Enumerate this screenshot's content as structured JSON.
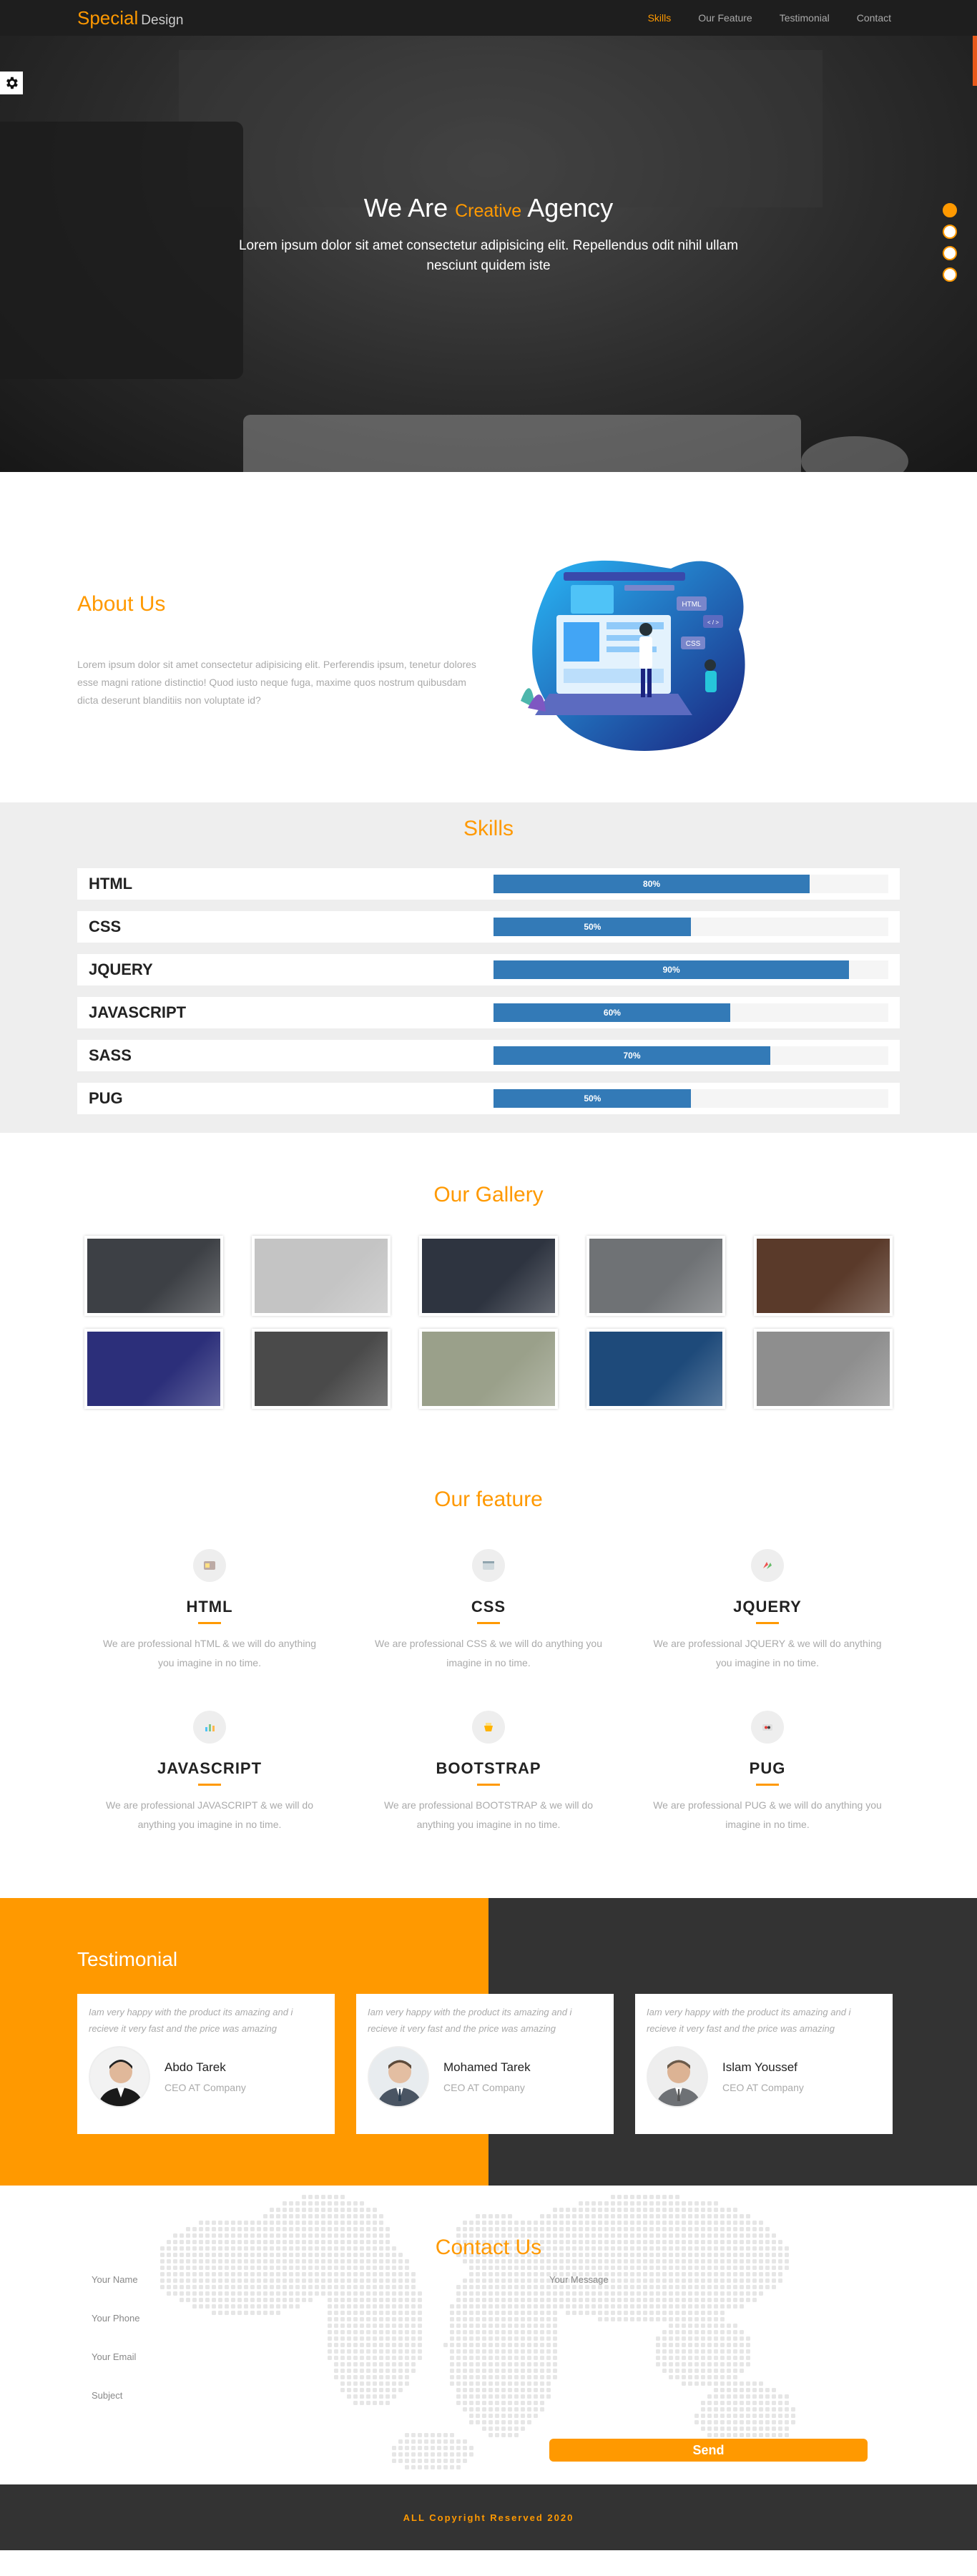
{
  "header": {
    "logo_brand": "Special",
    "logo_rest": "Design",
    "nav": [
      {
        "label": "Skills",
        "active": true
      },
      {
        "label": "Our Feature",
        "active": false
      },
      {
        "label": "Testimonial",
        "active": false
      },
      {
        "label": "Contact",
        "active": false
      }
    ]
  },
  "hero": {
    "title_start": "We Are",
    "title_accent": "Creative",
    "title_end": "Agency",
    "subtitle": "Lorem ipsum dolor sit amet consectetur adipisicing elit. Repellendus odit nihil ullam nesciunt quidem iste",
    "settings_icon": "gear-icon",
    "slides": 4,
    "active_slide": 1
  },
  "about": {
    "title": "About Us",
    "text": "Lorem ipsum dolor sit amet consectetur adipisicing elit. Perferendis ipsum, tenetur dolores esse magni ratione distinctio! Quod iusto neque fuga, maxime quos nostrum quibusdam dicta deserunt blanditiis non voluptate id?",
    "illustration_labels": [
      "HTML",
      "CSS",
      "< / >"
    ]
  },
  "skills": {
    "title": "Skills",
    "items": [
      {
        "name": "HTML",
        "value": 80,
        "label": "80%"
      },
      {
        "name": "CSS",
        "value": 50,
        "label": "50%"
      },
      {
        "name": "JQUERY",
        "value": 90,
        "label": "90%"
      },
      {
        "name": "JAVASCRIPT",
        "value": 60,
        "label": "60%"
      },
      {
        "name": "SASS",
        "value": 70,
        "label": "70%"
      },
      {
        "name": "PUG",
        "value": 50,
        "label": "50%"
      }
    ]
  },
  "gallery": {
    "title": "Our Gallery",
    "colors": [
      "#3d4045",
      "#c4c4c4",
      "#2e3440",
      "#6f7275",
      "#5a3a2a",
      "#2c2f7a",
      "#4a4a4a",
      "#9aa08a",
      "#1e4a7a",
      "#8e8e8e"
    ]
  },
  "features": {
    "title": "Our feature",
    "items": [
      {
        "name": "HTML",
        "desc": "We are professional hTML & we will do anything you imagine in no time."
      },
      {
        "name": "CSS",
        "desc": "We are professional CSS & we will do anything you imagine in no time."
      },
      {
        "name": "JQUERY",
        "desc": "We are professional JQUERY & we will do anything you imagine in no time."
      },
      {
        "name": "JAVASCRIPT",
        "desc": "We are professional JAVASCRIPT & we will do anything you imagine in no time."
      },
      {
        "name": "BOOTSTRAP",
        "desc": "We are professional BOOTSTRAP & we will do anything you imagine in no time."
      },
      {
        "name": "PUG",
        "desc": "We are professional PUG & we will do anything you imagine in no time."
      }
    ]
  },
  "testimonial": {
    "title": "Testimonial",
    "colors": {
      "left": "#ff9900",
      "right": "#333333"
    },
    "items": [
      {
        "quote": "Iam very happy with the product its amazing and i recieve it very fast and the price was amazing",
        "name": "Abdo Tarek",
        "role": "CEO AT Company"
      },
      {
        "quote": "Iam very happy with the product its amazing and i recieve it very fast and the price was amazing",
        "name": "Mohamed Tarek",
        "role": "CEO AT Company"
      },
      {
        "quote": "Iam very happy with the product its amazing and i recieve it very fast and the price was amazing",
        "name": "Islam Youssef",
        "role": "CEO AT Company"
      }
    ]
  },
  "contact": {
    "title": "Contact Us",
    "fields": [
      {
        "placeholder": "Your Name"
      },
      {
        "placeholder": "Your Phone"
      },
      {
        "placeholder": "Your Email"
      },
      {
        "placeholder": "Subject"
      }
    ],
    "message_placeholder": "Your Message",
    "send_label": "Send"
  },
  "footer": {
    "text": "ALL Copyright Reserved 2020"
  },
  "theme": {
    "accent": "#ff9900",
    "dark": "#333333",
    "progress": "#337ab7"
  }
}
